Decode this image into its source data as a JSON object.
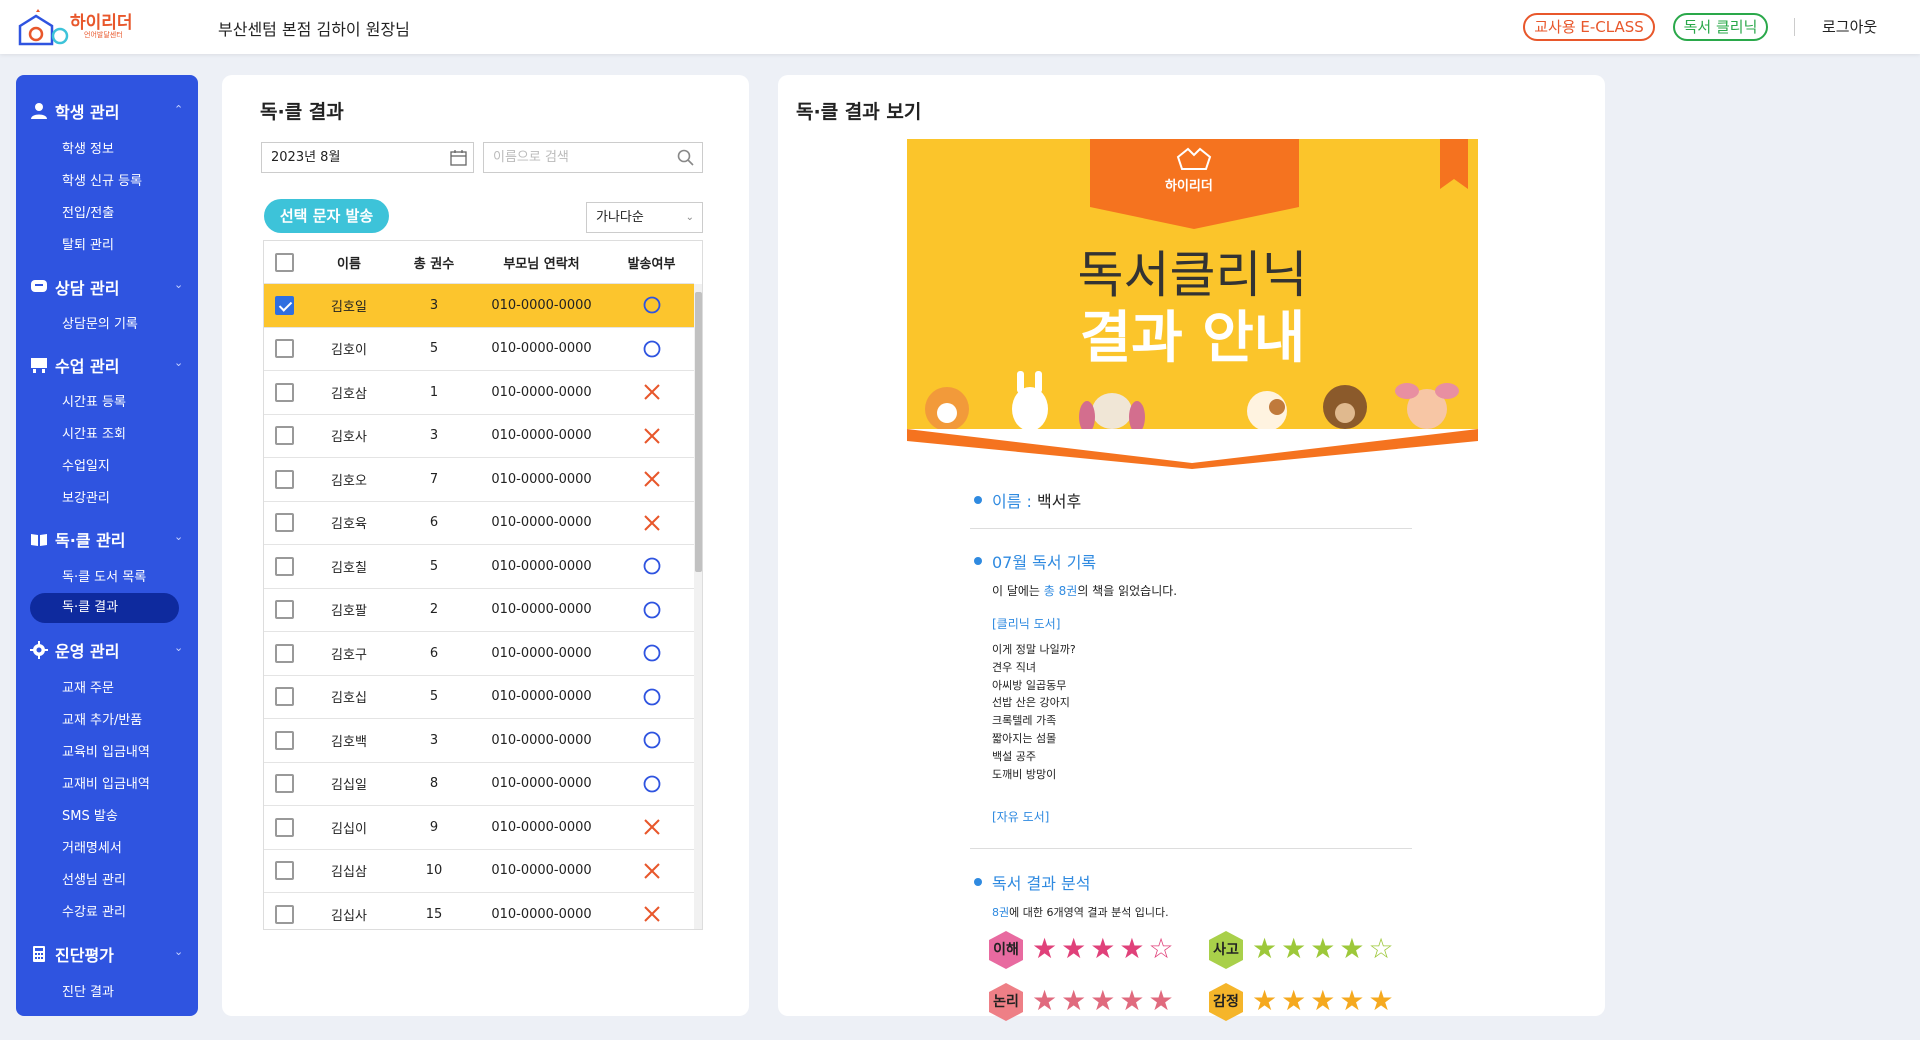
{
  "header": {
    "logo_text": "하이리더",
    "logo_sub": "언어발달센터",
    "title": "부산센텀 본점 김하이 원장님",
    "eclass_label": "교사용 E-CLASS",
    "clinic_label": "독서 클리닉",
    "logout_label": "로그아웃"
  },
  "sidebar": {
    "sections": [
      {
        "label": "학생 관리",
        "items": [
          "학생 정보",
          "학생 신규 등록",
          "전입/전출",
          "탈퇴 관리"
        ]
      },
      {
        "label": "상담 관리",
        "items": [
          "상담문의 기록"
        ]
      },
      {
        "label": "수업 관리",
        "items": [
          "시간표 등록",
          "시간표 조회",
          "수업일지",
          "보강관리"
        ]
      },
      {
        "label": "독·클 관리",
        "items": [
          "독·클 도서 목록",
          "독·클 결과"
        ]
      },
      {
        "label": "운영 관리",
        "items": [
          "교재 주문",
          "교재 추가/반품",
          "교육비 입금내역",
          "교재비 입금내역",
          "SMS 발송",
          "거래명세서",
          "선생님 관리",
          "수강료 관리"
        ]
      },
      {
        "label": "진단평가",
        "items": [
          "진단 결과"
        ]
      }
    ],
    "active_item": "독·클 결과"
  },
  "list_panel": {
    "title": "독·클 결과",
    "date_value": "2023년 8월",
    "search_placeholder": "이름으로 검색",
    "sms_button": "선택 문자 발송",
    "sort_value": "가나다순",
    "columns": [
      "이름",
      "총 권수",
      "부모님 연락처",
      "발송여부"
    ],
    "rows": [
      {
        "name": "김호일",
        "count": "3",
        "phone": "010-0000-0000",
        "sent": true,
        "checked": true
      },
      {
        "name": "김호이",
        "count": "5",
        "phone": "010-0000-0000",
        "sent": true,
        "checked": false
      },
      {
        "name": "김호삼",
        "count": "1",
        "phone": "010-0000-0000",
        "sent": false,
        "checked": false
      },
      {
        "name": "김호사",
        "count": "3",
        "phone": "010-0000-0000",
        "sent": false,
        "checked": false
      },
      {
        "name": "김호오",
        "count": "7",
        "phone": "010-0000-0000",
        "sent": false,
        "checked": false
      },
      {
        "name": "김호육",
        "count": "6",
        "phone": "010-0000-0000",
        "sent": false,
        "checked": false
      },
      {
        "name": "김호칠",
        "count": "5",
        "phone": "010-0000-0000",
        "sent": true,
        "checked": false
      },
      {
        "name": "김호팔",
        "count": "2",
        "phone": "010-0000-0000",
        "sent": true,
        "checked": false
      },
      {
        "name": "김호구",
        "count": "6",
        "phone": "010-0000-0000",
        "sent": true,
        "checked": false
      },
      {
        "name": "김호십",
        "count": "5",
        "phone": "010-0000-0000",
        "sent": true,
        "checked": false
      },
      {
        "name": "김호백",
        "count": "3",
        "phone": "010-0000-0000",
        "sent": true,
        "checked": false
      },
      {
        "name": "김십일",
        "count": "8",
        "phone": "010-0000-0000",
        "sent": true,
        "checked": false
      },
      {
        "name": "김십이",
        "count": "9",
        "phone": "010-0000-0000",
        "sent": false,
        "checked": false
      },
      {
        "name": "김십삼",
        "count": "10",
        "phone": "010-0000-0000",
        "sent": false,
        "checked": false
      },
      {
        "name": "김십사",
        "count": "15",
        "phone": "010-0000-0000",
        "sent": false,
        "checked": false
      }
    ]
  },
  "result_panel": {
    "title": "독·클 결과 보기",
    "poster_logo": "하이리더",
    "poster_title_1": "독서클리닉",
    "poster_title_2": "결과 안내",
    "name_label": "이름 :",
    "name_value": "백서후",
    "record_heading": "07월 독서 기록",
    "record_prefix": "이 달에는 ",
    "record_highlight": "총 8권",
    "record_suffix": "의 책을 읽었습니다.",
    "clinic_books_label": "[클리닉 도서]",
    "clinic_books": [
      "이게 정말 나일까?",
      "견우 직녀",
      "아씨방 일곱동무",
      "선밥 산은 강아지",
      "크록텔레 가족",
      "짧아지는 섬몰",
      "백설 공주",
      "도깨비 방망이"
    ],
    "free_books_label": "[자유 도서]",
    "analysis_heading": "독서 결과 분석",
    "analysis_highlight": "8권",
    "analysis_text": "에 대한 6개영역 결과 분석 입니다.",
    "scores": [
      {
        "label": "이해",
        "stars": 4,
        "color": "#e0417a",
        "hex": "#e86aa0"
      },
      {
        "label": "사고",
        "stars": 4,
        "color": "#9dc83a",
        "hex": "#a9d04a"
      },
      {
        "label": "논리",
        "stars": 5,
        "color": "#e06a7e",
        "hex": "#ee7f86"
      },
      {
        "label": "감정",
        "stars": 5,
        "color": "#f5a91f",
        "hex": "#f5b52a"
      }
    ]
  }
}
